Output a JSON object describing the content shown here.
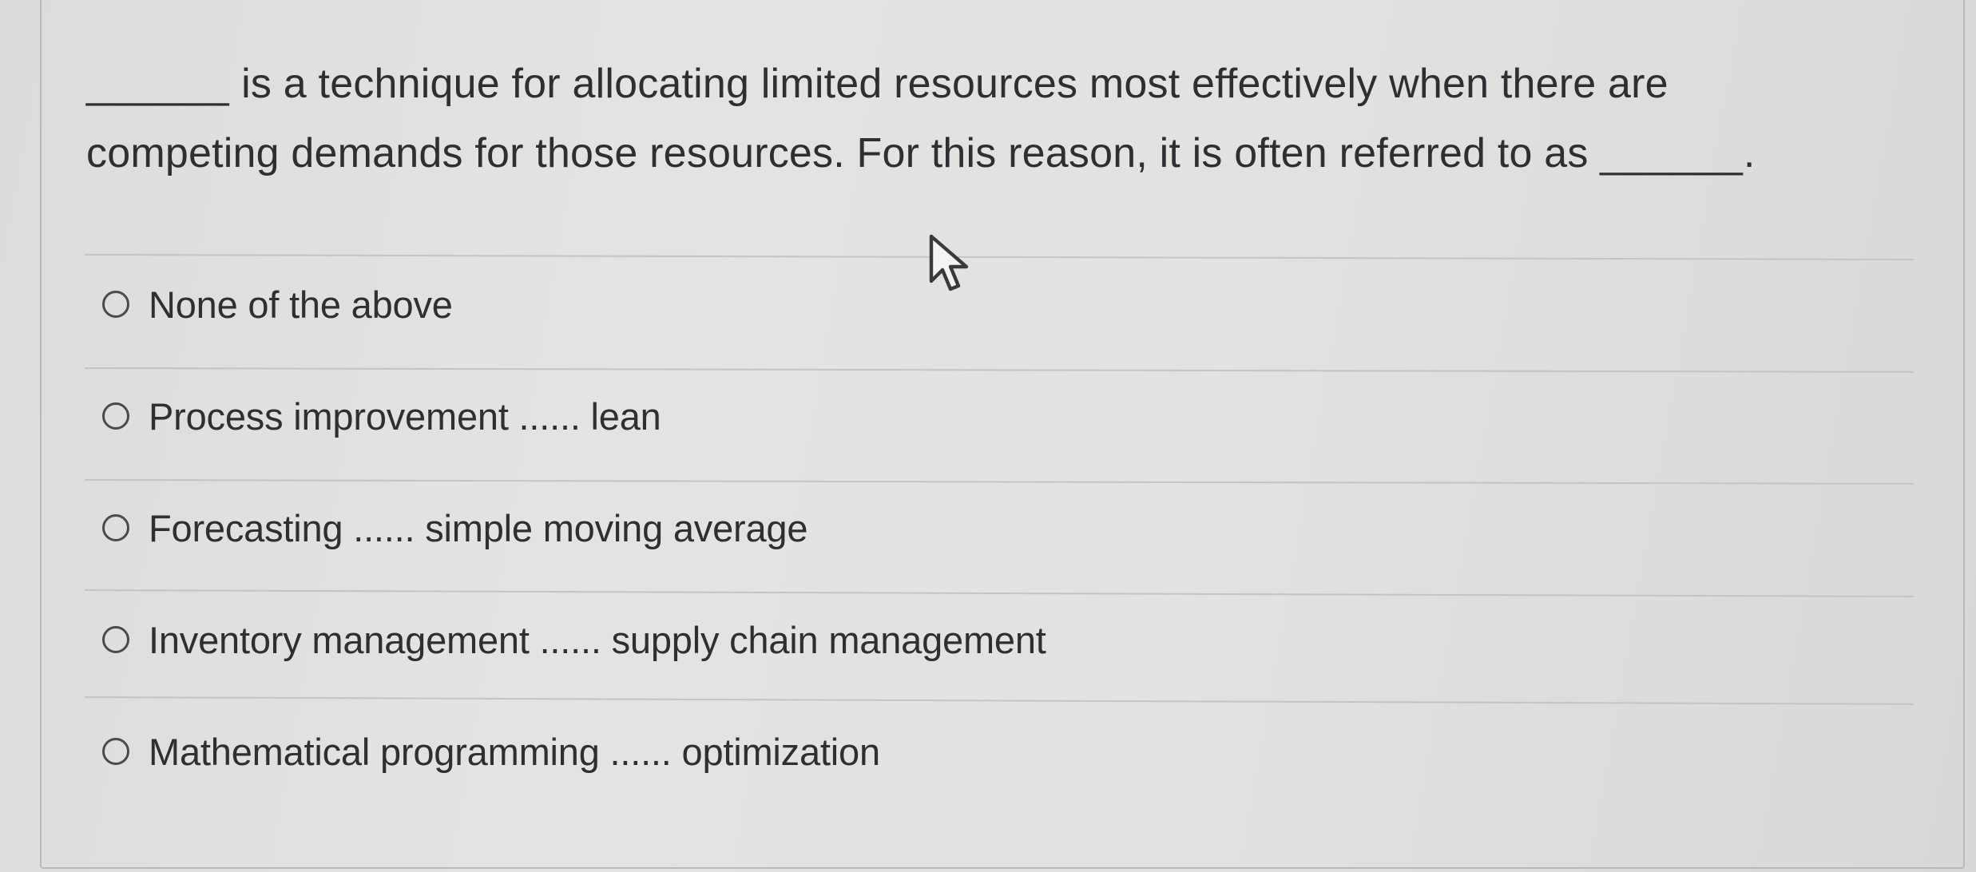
{
  "question": {
    "line1_blank": "______",
    "line1_text": " is a technique for allocating limited resources most effectively when there are",
    "line2_text": "competing demands for those resources. For this reason, it is often referred to as ",
    "line2_blank": "______",
    "line2_end": "."
  },
  "options": [
    {
      "label": "None of the above",
      "selected": false
    },
    {
      "label": "Process improvement ...... lean",
      "selected": false
    },
    {
      "label": "Forecasting ...... simple moving average",
      "selected": false
    },
    {
      "label": "Inventory management ...... supply chain management",
      "selected": false
    },
    {
      "label": "Mathematical programming ...... optimization",
      "selected": false
    }
  ],
  "cursor_icon": "mouse-pointer-icon"
}
